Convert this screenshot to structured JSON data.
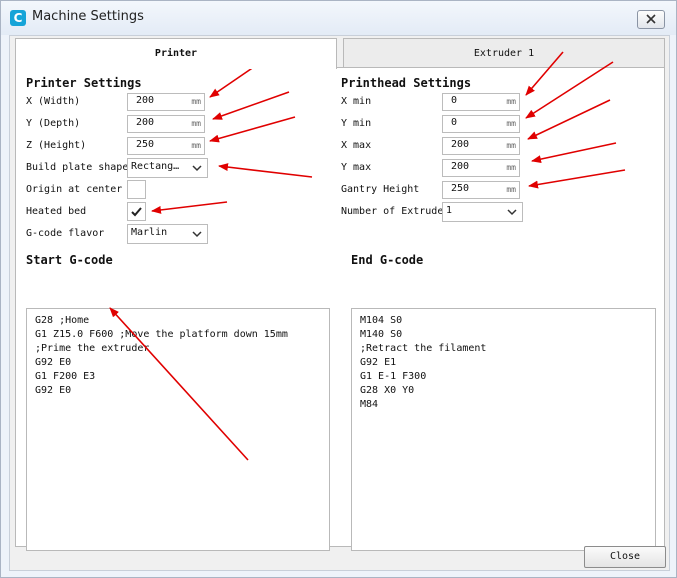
{
  "window": {
    "title": "Machine Settings",
    "app_icon": "C"
  },
  "tabs": [
    {
      "label": "Printer"
    },
    {
      "label": "Extruder 1"
    }
  ],
  "printer": {
    "heading": "Printer Settings",
    "x": {
      "label": "X (Width)",
      "value": "200",
      "unit": "mm"
    },
    "y": {
      "label": "Y (Depth)",
      "value": "200",
      "unit": "mm"
    },
    "z": {
      "label": "Z (Height)",
      "value": "250",
      "unit": "mm"
    },
    "build_plate": {
      "label": "Build plate shape",
      "value": "Rectang…"
    },
    "origin": {
      "label": "Origin at center",
      "checked": false
    },
    "heated_bed": {
      "label": "Heated bed",
      "checked": true
    },
    "gcode_flavor": {
      "label": "G-code flavor",
      "value": "Marlin"
    }
  },
  "printhead": {
    "heading": "Printhead Settings",
    "xmin": {
      "label": "X min",
      "value": "0",
      "unit": "mm"
    },
    "ymin": {
      "label": "Y min",
      "value": "0",
      "unit": "mm"
    },
    "xmax": {
      "label": "X max",
      "value": "200",
      "unit": "mm"
    },
    "ymax": {
      "label": "Y max",
      "value": "200",
      "unit": "mm"
    },
    "gantry": {
      "label": "Gantry Height",
      "value": "250",
      "unit": "mm"
    },
    "extruders": {
      "label": "Number of Extruders",
      "value": "1"
    }
  },
  "start_gcode": {
    "heading": "Start G-code",
    "lines": [
      "G28 ;Home",
      "G1 Z15.0 F600 ;Move the platform down 15mm",
      ";Prime the extruder",
      "G92 E0",
      "G1 F200 E3",
      "G92 E0"
    ]
  },
  "end_gcode": {
    "heading": "End G-code",
    "lines": [
      "M104 S0",
      "M140 S0",
      ";Retract the filament",
      "G92 E1",
      "G1 E-1 F300",
      "G28 X0 Y0",
      "M84"
    ]
  },
  "buttons": {
    "close": "Close"
  },
  "colors": {
    "arrow": "#e00000",
    "accent": "#16a4d8"
  }
}
